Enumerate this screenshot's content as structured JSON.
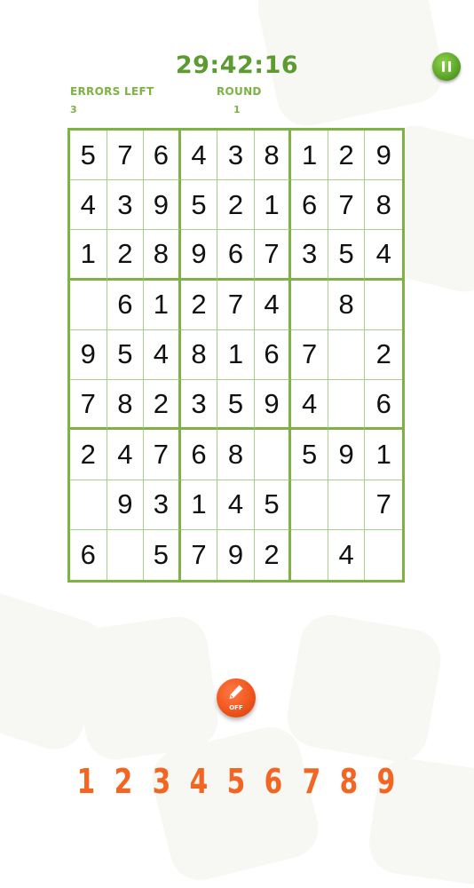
{
  "header": {
    "timer": "29:42:16",
    "errors_label": "ERRORS LEFT",
    "errors_value": "3",
    "round_label": "ROUND",
    "round_value": "1"
  },
  "board": {
    "rows": [
      [
        "5",
        "7",
        "6",
        "4",
        "3",
        "8",
        "1",
        "2",
        "9"
      ],
      [
        "4",
        "3",
        "9",
        "5",
        "2",
        "1",
        "6",
        "7",
        "8"
      ],
      [
        "1",
        "2",
        "8",
        "9",
        "6",
        "7",
        "3",
        "5",
        "4"
      ],
      [
        "",
        "6",
        "1",
        "2",
        "7",
        "4",
        "",
        "8",
        ""
      ],
      [
        "9",
        "5",
        "4",
        "8",
        "1",
        "6",
        "7",
        "",
        "2"
      ],
      [
        "7",
        "8",
        "2",
        "3",
        "5",
        "9",
        "4",
        "",
        "6"
      ],
      [
        "2",
        "4",
        "7",
        "6",
        "8",
        "",
        "5",
        "9",
        "1"
      ],
      [
        "",
        "9",
        "3",
        "1",
        "4",
        "5",
        "",
        "",
        "7"
      ],
      [
        "6",
        "",
        "5",
        "7",
        "9",
        "2",
        "",
        "4",
        ""
      ]
    ]
  },
  "pencil": {
    "label": "OFF",
    "icon": "pencil-icon"
  },
  "numpad": [
    "1",
    "2",
    "3",
    "4",
    "5",
    "6",
    "7",
    "8",
    "9"
  ],
  "colors": {
    "accent_green": "#7cb342",
    "timer_green": "#5c9b31",
    "orange": "#f26522"
  }
}
